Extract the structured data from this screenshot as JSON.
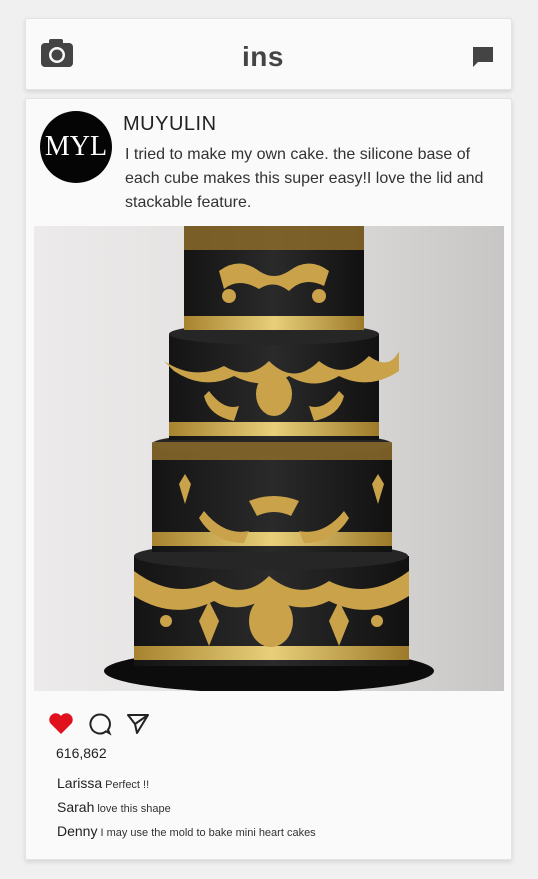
{
  "header": {
    "brand": "ins",
    "camera_icon": "camera-icon",
    "message_icon": "message-icon"
  },
  "post": {
    "avatar_text": "MYL",
    "username": "MUYULIN",
    "caption": "I tried to make my own cake. the silicone base of each cube makes this super easy!I love the lid and stackable feature.",
    "image_desc": "cake-photo",
    "likes": "616,862",
    "comments": [
      {
        "user": "Larissa",
        "text": "Perfect !!"
      },
      {
        "user": "Sarah",
        "text": "love this shape"
      },
      {
        "user": "Denny",
        "text": "I may use the mold to bake mini heart cakes"
      }
    ]
  },
  "colors": {
    "like": "#e0101c",
    "cake": "#1c1c1c",
    "gold": "#c9a24a"
  }
}
